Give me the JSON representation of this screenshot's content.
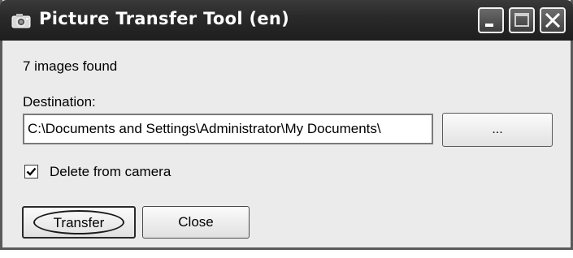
{
  "window": {
    "title": "Picture Transfer Tool (en)",
    "app_icon": "camera-app-icon"
  },
  "titlebar_buttons": {
    "minimize_icon": "minimize-icon",
    "maximize_icon": "maximize-icon",
    "close_icon": "close-icon"
  },
  "status": {
    "count_text": "7 images found"
  },
  "destination": {
    "label": "Destination:",
    "path_value": "C:\\Documents and Settings\\Administrator\\My Documents\\",
    "browse_label": "..."
  },
  "options": {
    "delete_from_camera_label": "Delete from camera",
    "delete_from_camera_checked": true
  },
  "actions": {
    "transfer_label": "Transfer",
    "close_label": "Close"
  },
  "colors": {
    "titlebar": "#2a2a2a",
    "window_bg": "#ebebeb",
    "border": "#5a5a5a"
  }
}
